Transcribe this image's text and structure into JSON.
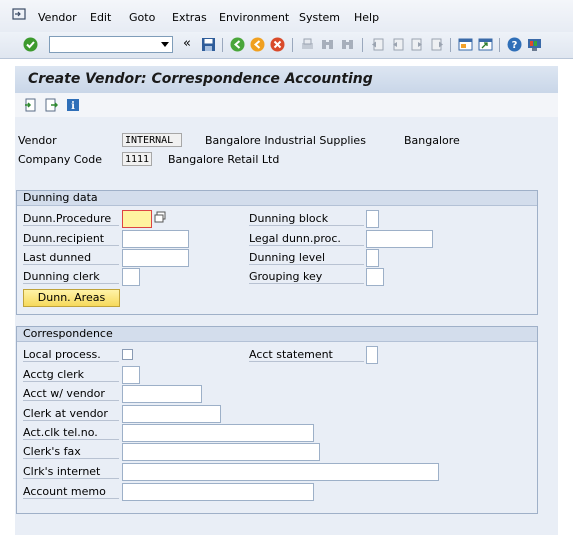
{
  "menu": {
    "items": [
      "Vendor",
      "Edit",
      "Goto",
      "Extras",
      "Environment",
      "System",
      "Help"
    ]
  },
  "toolbar": {
    "command_field": "",
    "icons": [
      "check-icon",
      "double-arrow-icon",
      "save-icon",
      "back-icon",
      "exit-icon",
      "cancel-icon",
      "print-icon",
      "find-icon",
      "find-next-icon",
      "first-page-icon",
      "previous-page-icon",
      "next-page-icon",
      "last-page-icon",
      "create-session-icon",
      "shortcut-icon",
      "help-icon",
      "customize-icon"
    ]
  },
  "title": "Create Vendor: Correspondence Accounting",
  "app_toolbar": {
    "icons": [
      "previous-screen-icon",
      "next-screen-icon",
      "info-icon"
    ]
  },
  "header": {
    "vendor_label": "Vendor",
    "vendor_value": "INTERNAL",
    "vendor_name": "Bangalore Industrial Supplies",
    "vendor_city": "Bangalore",
    "company_label": "Company Code",
    "company_value": "1111",
    "company_name": "Bangalore Retail Ltd"
  },
  "dunning": {
    "title": "Dunning data",
    "procedure_label": "Dunn.Procedure",
    "procedure_value": "",
    "recipient_label": "Dunn.recipient",
    "last_dunned_label": "Last dunned",
    "clerk_label": "Dunning clerk",
    "areas_button": "Dunn. Areas",
    "block_label": "Dunning block",
    "legal_label": "Legal dunn.proc.",
    "level_label": "Dunning level",
    "grouping_label": "Grouping key"
  },
  "correspondence": {
    "title": "Correspondence",
    "local_process_label": "Local process.",
    "acct_statement_label": "Acct statement",
    "acctg_clerk_label": "Acctg clerk",
    "acct_vendor_label": "Acct w/ vendor",
    "clerk_vendor_label": "Clerk at vendor",
    "tel_label": "Act.clk tel.no.",
    "fax_label": "Clerk's fax",
    "internet_label": "Clrk's internet",
    "memo_label": "Account memo"
  },
  "colors": {
    "title_bg": "#c9d6e8",
    "group_bg": "#e9eef6",
    "button_bg": "#f6d95c",
    "required_field": "#fff3a0"
  }
}
